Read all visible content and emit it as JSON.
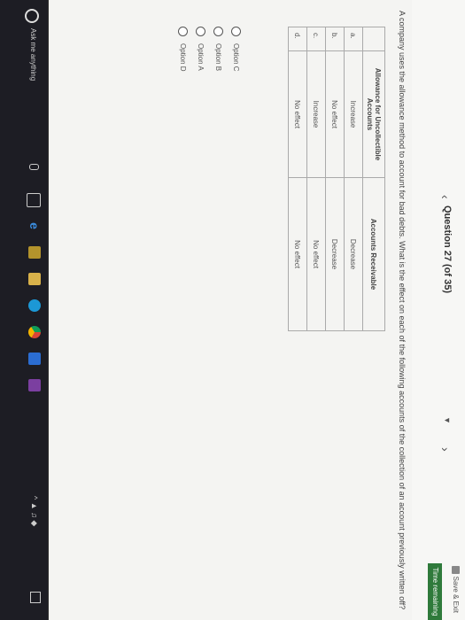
{
  "header": {
    "question_label": "Question 27 (of 35)",
    "save_label": "Save & Exit",
    "timer_label": "Time remaining"
  },
  "question_text": "A company uses the allowance method to account for bad debts. What is the effect on each of the following accounts of the collection of an account previously written off?",
  "table": {
    "headers": [
      "",
      "Allowance for Uncollectible Accounts",
      "Accounts Receivable"
    ],
    "rows": [
      [
        "a.",
        "Increase",
        "Decrease"
      ],
      [
        "b.",
        "No effect",
        "Decrease"
      ],
      [
        "c.",
        "Increase",
        "No effect"
      ],
      [
        "d.",
        "No effect",
        "No effect"
      ]
    ]
  },
  "options": [
    "Option C",
    "Option B",
    "Option A",
    "Option D"
  ],
  "taskbar": {
    "search_placeholder": "Ask me anything"
  }
}
